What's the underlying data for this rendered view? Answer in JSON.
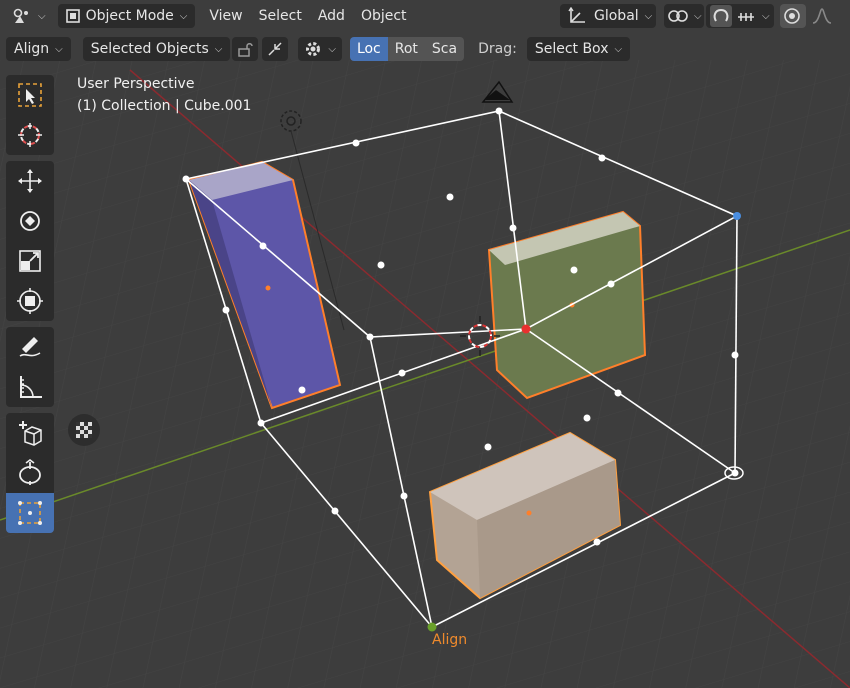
{
  "header": {
    "mode_label": "Object Mode",
    "menus": [
      "View",
      "Select",
      "Add",
      "Object"
    ],
    "orientation_label": "Global"
  },
  "toolsettings": {
    "tool_label": "Align",
    "selected_label": "Selected Objects",
    "transform_toggles": [
      "Loc",
      "Rot",
      "Sca"
    ],
    "drag_label": "Drag:",
    "drag_value": "Select Box"
  },
  "viewport": {
    "perspective": "User Perspective",
    "collection_info": "(1) Collection | Cube.001",
    "align_label": "Align"
  },
  "colors": {
    "accent": "#4772b3",
    "selection": "#ff7f2a",
    "align_label": "#ef8a2c",
    "x_axis": "#8b2a2f",
    "y_axis": "#6a8a2a"
  },
  "icons": [
    "cursor-icon",
    "select-box-icon",
    "cursor-3d-icon",
    "move-icon",
    "rotate-icon",
    "scale-icon",
    "transform-icon",
    "annotate-icon",
    "measure-icon",
    "add-cube-icon",
    "spin-icon",
    "align-tool-icon",
    "camera-view-icon",
    "light-icon",
    "proportional-icon",
    "snap-icon",
    "overlay-icon"
  ]
}
